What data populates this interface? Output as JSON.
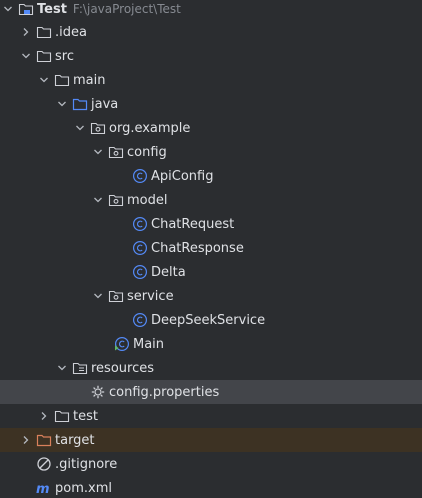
{
  "project": {
    "name": "Test",
    "path": "F:\\javaProject\\Test"
  },
  "items": [
    {
      "label": "Test",
      "icon": "project-folder-icon"
    },
    {
      "label": ".idea",
      "icon": "folder-icon"
    },
    {
      "label": "src",
      "icon": "folder-icon"
    },
    {
      "label": "main",
      "icon": "folder-icon"
    },
    {
      "label": "java",
      "icon": "source-root-folder-icon"
    },
    {
      "label": "org.example",
      "icon": "package-icon"
    },
    {
      "label": "config",
      "icon": "package-icon"
    },
    {
      "label": "ApiConfig",
      "icon": "java-class-icon"
    },
    {
      "label": "model",
      "icon": "package-icon"
    },
    {
      "label": "ChatRequest",
      "icon": "java-class-icon"
    },
    {
      "label": "ChatResponse",
      "icon": "java-class-icon"
    },
    {
      "label": "Delta",
      "icon": "java-class-icon"
    },
    {
      "label": "service",
      "icon": "package-icon"
    },
    {
      "label": "DeepSeekService",
      "icon": "java-class-icon"
    },
    {
      "label": "Main",
      "icon": "java-main-class-icon"
    },
    {
      "label": "resources",
      "icon": "resources-folder-icon"
    },
    {
      "label": "config.properties",
      "icon": "properties-file-icon"
    },
    {
      "label": "test",
      "icon": "folder-icon"
    },
    {
      "label": "target",
      "icon": "excluded-folder-icon"
    },
    {
      "label": ".gitignore",
      "icon": "gitignore-file-icon"
    },
    {
      "label": "pom.xml",
      "icon": "maven-file-icon"
    }
  ],
  "colors": {
    "background": "#2b2d30",
    "selected_row": "#43454a",
    "excluded_row": "#3d3223",
    "text": "#dfe1e5",
    "secondary_text": "#868a91",
    "class_icon": "#548af7",
    "source_folder": "#548af7",
    "excluded_folder": "#d9805b"
  }
}
